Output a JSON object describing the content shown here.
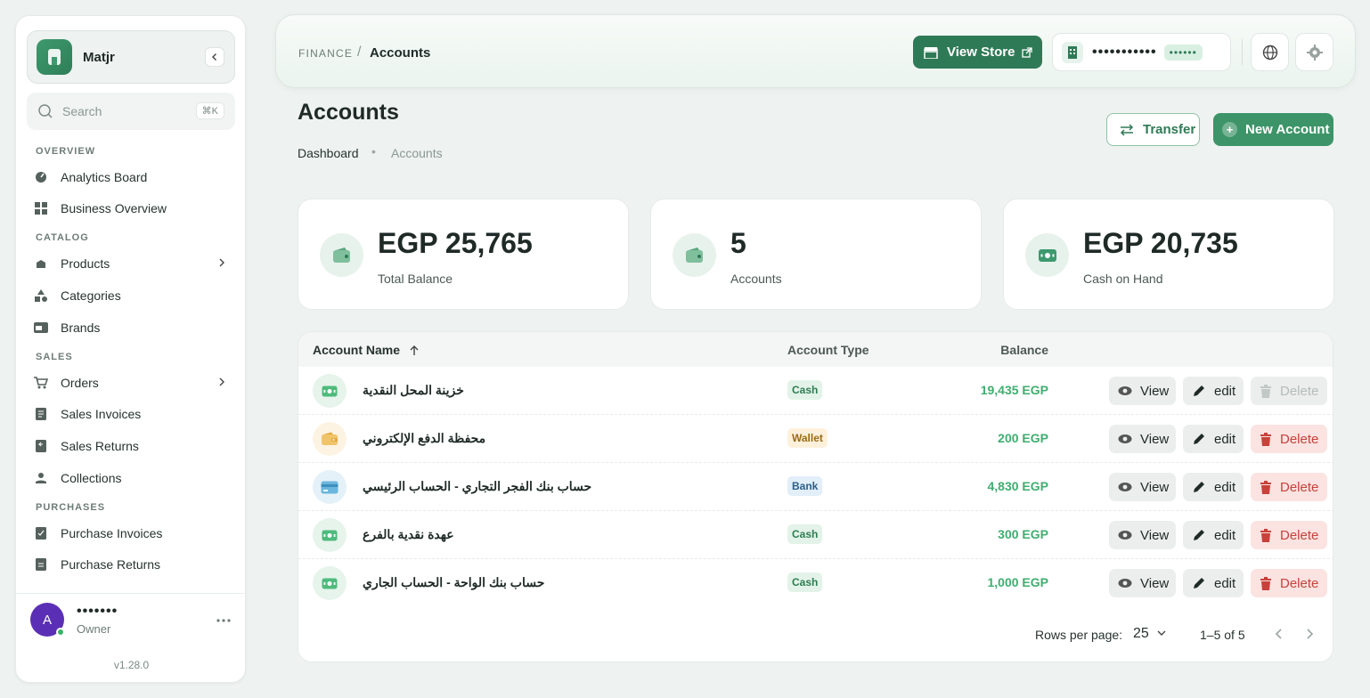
{
  "sidebar": {
    "brand": "Matjr",
    "search_placeholder": "Search",
    "search_shortcut": "⌘K",
    "sections": {
      "overview": "OVERVIEW",
      "catalog": "CATALOG",
      "sales": "SALES",
      "purchases": "PURCHASES"
    },
    "items": {
      "analytics": "Analytics Board",
      "business": "Business Overview",
      "products": "Products",
      "categories": "Categories",
      "brands": "Brands",
      "orders": "Orders",
      "sales_invoices": "Sales Invoices",
      "sales_returns": "Sales Returns",
      "collections": "Collections",
      "purchase_invoices": "Purchase Invoices",
      "purchase_returns": "Purchase Returns"
    },
    "user": {
      "initial": "A",
      "name": "•••••••",
      "role": "Owner"
    },
    "version": "v1.28.0"
  },
  "topbar": {
    "crumb_section": "FINANCE",
    "crumb_sep": "/",
    "crumb_current": "Accounts",
    "view_store": "View Store",
    "store_name": "•••••••••••",
    "store_badge": "••••••"
  },
  "page": {
    "title": "Accounts",
    "breadcrumb_home": "Dashboard",
    "breadcrumb_dot": "•",
    "breadcrumb_current": "Accounts",
    "transfer_label": "Transfer",
    "new_account_label": "New Account"
  },
  "stats": [
    {
      "value": "EGP 25,765",
      "label": "Total Balance",
      "icon": "wallet-icon"
    },
    {
      "value": "5",
      "label": "Accounts",
      "icon": "wallet-icon"
    },
    {
      "value": "EGP 20,735",
      "label": "Cash on Hand",
      "icon": "cash-icon"
    }
  ],
  "table": {
    "columns": {
      "name": "Account Name",
      "type": "Account Type",
      "balance": "Balance"
    },
    "rows": [
      {
        "name": "خزينة المحل النقدية",
        "type": "Cash",
        "balance": "19,435 EGP",
        "icon": "cash-icon",
        "delete_disabled": true
      },
      {
        "name": "محفظة الدفع الإلكتروني",
        "type": "Wallet",
        "balance": "200 EGP",
        "icon": "wallet-icon",
        "delete_disabled": false
      },
      {
        "name": "حساب بنك الفجر التجاري - الحساب الرئيسي",
        "type": "Bank",
        "balance": "4,830 EGP",
        "icon": "bank-card-icon",
        "delete_disabled": false
      },
      {
        "name": "عهدة نقدية بالفرع",
        "type": "Cash",
        "balance": "300 EGP",
        "icon": "cash-icon",
        "delete_disabled": false
      },
      {
        "name": "حساب بنك الواحة - الحساب الجاري",
        "type": "Cash",
        "balance": "1,000 EGP",
        "icon": "cash-icon",
        "delete_disabled": false
      }
    ],
    "actions": {
      "view": "View",
      "edit": "edit",
      "delete": "Delete"
    },
    "footer": {
      "rows_per_page_label": "Rows per page:",
      "rows_per_page": "25",
      "range": "1–5 of 5"
    }
  },
  "colors": {
    "accent": "#2f7a56",
    "positive": "#3fae6f",
    "danger": "#c8413a"
  }
}
